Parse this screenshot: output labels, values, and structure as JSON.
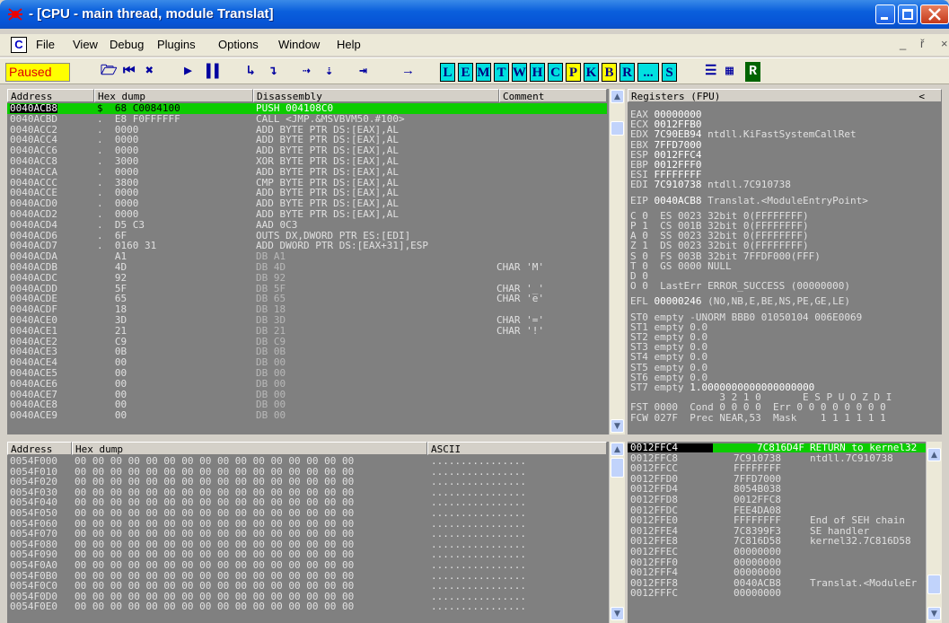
{
  "window": {
    "title": "- [CPU - main thread, module Translat]"
  },
  "menu": {
    "items": [
      "File",
      "View",
      "Debug",
      "Plugins",
      "Options",
      "Window",
      "Help"
    ],
    "mdi": [
      "_",
      "ř",
      "×"
    ]
  },
  "toolbar": {
    "status": "Paused",
    "letters": [
      "L",
      "E",
      "M",
      "T",
      "W",
      "H",
      "C",
      "P",
      "K",
      "B",
      "R",
      "...",
      "S"
    ],
    "highlight": [
      "P",
      "B"
    ]
  },
  "disasm": {
    "headers": {
      "address": "Address",
      "hex": "Hex dump",
      "disasm": "Disassembly",
      "comment": "Comment"
    },
    "rows": [
      [
        "0040ACB8",
        "$  68 C0084100",
        "PUSH 004108C0",
        ""
      ],
      [
        "0040ACBD",
        ".  E8 F0FFFFFF",
        "CALL <JMP.&MSVBVM50.#100>",
        ""
      ],
      [
        "0040ACC2",
        ".  0000",
        "ADD BYTE PTR DS:[EAX],AL",
        ""
      ],
      [
        "0040ACC4",
        ".  0000",
        "ADD BYTE PTR DS:[EAX],AL",
        ""
      ],
      [
        "0040ACC6",
        ".  0000",
        "ADD BYTE PTR DS:[EAX],AL",
        ""
      ],
      [
        "0040ACC8",
        ".  3000",
        "XOR BYTE PTR DS:[EAX],AL",
        ""
      ],
      [
        "0040ACCA",
        ".  0000",
        "ADD BYTE PTR DS:[EAX],AL",
        ""
      ],
      [
        "0040ACCC",
        ".  3800",
        "CMP BYTE PTR DS:[EAX],AL",
        ""
      ],
      [
        "0040ACCE",
        ".  0000",
        "ADD BYTE PTR DS:[EAX],AL",
        ""
      ],
      [
        "0040ACD0",
        ".  0000",
        "ADD BYTE PTR DS:[EAX],AL",
        ""
      ],
      [
        "0040ACD2",
        ".  0000",
        "ADD BYTE PTR DS:[EAX],AL",
        ""
      ],
      [
        "0040ACD4",
        ".  D5 C3",
        "AAD 0C3",
        ""
      ],
      [
        "0040ACD6",
        ".  6F",
        "OUTS DX,DWORD PTR ES:[EDI]",
        ""
      ],
      [
        "0040ACD7",
        ".  0160 31",
        "ADD DWORD PTR DS:[EAX+31],ESP",
        ""
      ],
      [
        "0040ACDA",
        "   A1",
        "DB A1",
        ""
      ],
      [
        "0040ACDB",
        "   4D",
        "DB 4D",
        "CHAR 'M'"
      ],
      [
        "0040ACDC",
        "   92",
        "DB 92",
        ""
      ],
      [
        "0040ACDD",
        "   5F",
        "DB 5F",
        "CHAR '_'"
      ],
      [
        "0040ACDE",
        "   65",
        "DB 65",
        "CHAR 'e'"
      ],
      [
        "0040ACDF",
        "   18",
        "DB 18",
        ""
      ],
      [
        "0040ACE0",
        "   3D",
        "DB 3D",
        "CHAR '='"
      ],
      [
        "0040ACE1",
        "   21",
        "DB 21",
        "CHAR '!'"
      ],
      [
        "0040ACE2",
        "   C9",
        "DB C9",
        ""
      ],
      [
        "0040ACE3",
        "   0B",
        "DB 0B",
        ""
      ],
      [
        "0040ACE4",
        "   00",
        "DB 00",
        ""
      ],
      [
        "0040ACE5",
        "   00",
        "DB 00",
        ""
      ],
      [
        "0040ACE6",
        "   00",
        "DB 00",
        ""
      ],
      [
        "0040ACE7",
        "   00",
        "DB 00",
        ""
      ],
      [
        "0040ACE8",
        "   00",
        "DB 00",
        ""
      ],
      [
        "0040ACE9",
        "   00",
        "DB 00",
        ""
      ]
    ]
  },
  "registers": {
    "header": "Registers (FPU)",
    "header_arrow": "<",
    "lines": [
      [
        "EAX ",
        "00000000",
        ""
      ],
      [
        "ECX ",
        "0012FFB0",
        ""
      ],
      [
        "EDX ",
        "7C90EB94",
        " ntdll.KiFastSystemCallRet"
      ],
      [
        "EBX ",
        "7FFD7000",
        ""
      ],
      [
        "ESP ",
        "0012FFC4",
        ""
      ],
      [
        "EBP ",
        "0012FFF0",
        ""
      ],
      [
        "ESI ",
        "FFFFFFFF",
        ""
      ],
      [
        "EDI ",
        "7C910738",
        " ntdll.7C910738"
      ],
      [
        "",
        "",
        ""
      ],
      [
        "EIP ",
        "0040ACB8",
        " Translat.<ModuleEntryPoint>"
      ],
      [
        "",
        "",
        ""
      ],
      [
        "C 0  ES 0023 32bit 0(FFFFFFFF)",
        "",
        ""
      ],
      [
        "P 1  CS 001B 32bit 0(FFFFFFFF)",
        "",
        ""
      ],
      [
        "A 0  SS 0023 32bit 0(FFFFFFFF)",
        "",
        ""
      ],
      [
        "Z 1  DS 0023 32bit 0(FFFFFFFF)",
        "",
        ""
      ],
      [
        "S 0  FS 003B 32bit 7FFDF000(FFF)",
        "",
        ""
      ],
      [
        "T 0  GS 0000 NULL",
        "",
        ""
      ],
      [
        "D 0",
        "",
        ""
      ],
      [
        "O 0  LastErr ERROR_SUCCESS (00000000)",
        "",
        ""
      ],
      [
        "",
        "",
        ""
      ],
      [
        "EFL ",
        "00000246",
        " (NO,NB,E,BE,NS,PE,GE,LE)"
      ],
      [
        "",
        "",
        ""
      ],
      [
        "ST0 empty -UNORM BBB0 01050104 006E0069",
        "",
        ""
      ],
      [
        "ST1 empty 0.0",
        "",
        ""
      ],
      [
        "ST2 empty 0.0",
        "",
        ""
      ],
      [
        "ST3 empty 0.0",
        "",
        ""
      ],
      [
        "ST4 empty 0.0",
        "",
        ""
      ],
      [
        "ST5 empty 0.0",
        "",
        ""
      ],
      [
        "ST6 empty 0.0",
        "",
        ""
      ],
      [
        "ST7 empty ",
        "1.0000000000000000000",
        ""
      ],
      [
        "               3 2 1 0       E S P U O Z D I",
        "",
        ""
      ],
      [
        "FST 0000  Cond 0 0 0 0  Err 0 0 0 0 0 0 0 0",
        "",
        ""
      ],
      [
        "FCW 027F  Prec NEAR,53  Mask    1 1 1 1 1 1",
        "",
        ""
      ]
    ]
  },
  "dump": {
    "headers": {
      "address": "Address",
      "hex": "Hex dump",
      "ascii": "ASCII"
    },
    "rows": [
      [
        "0054F000",
        "00 00 00 00 00 00 00 00 00 00 00 00 00 00 00 00",
        "................"
      ],
      [
        "0054F010",
        "00 00 00 00 00 00 00 00 00 00 00 00 00 00 00 00",
        "................"
      ],
      [
        "0054F020",
        "00 00 00 00 00 00 00 00 00 00 00 00 00 00 00 00",
        "................"
      ],
      [
        "0054F030",
        "00 00 00 00 00 00 00 00 00 00 00 00 00 00 00 00",
        "................"
      ],
      [
        "0054F040",
        "00 00 00 00 00 00 00 00 00 00 00 00 00 00 00 00",
        "................"
      ],
      [
        "0054F050",
        "00 00 00 00 00 00 00 00 00 00 00 00 00 00 00 00",
        "................"
      ],
      [
        "0054F060",
        "00 00 00 00 00 00 00 00 00 00 00 00 00 00 00 00",
        "................"
      ],
      [
        "0054F070",
        "00 00 00 00 00 00 00 00 00 00 00 00 00 00 00 00",
        "................"
      ],
      [
        "0054F080",
        "00 00 00 00 00 00 00 00 00 00 00 00 00 00 00 00",
        "................"
      ],
      [
        "0054F090",
        "00 00 00 00 00 00 00 00 00 00 00 00 00 00 00 00",
        "................"
      ],
      [
        "0054F0A0",
        "00 00 00 00 00 00 00 00 00 00 00 00 00 00 00 00",
        "................"
      ],
      [
        "0054F0B0",
        "00 00 00 00 00 00 00 00 00 00 00 00 00 00 00 00",
        "................"
      ],
      [
        "0054F0C0",
        "00 00 00 00 00 00 00 00 00 00 00 00 00 00 00 00",
        "................"
      ],
      [
        "0054F0D0",
        "00 00 00 00 00 00 00 00 00 00 00 00 00 00 00 00",
        "................"
      ],
      [
        "0054F0E0",
        "00 00 00 00 00 00 00 00 00 00 00 00 00 00 00 00",
        "................"
      ]
    ]
  },
  "stack": {
    "rows": [
      [
        "0012FFC4",
        "7C816D4F",
        "RETURN to kernel32"
      ],
      [
        "0012FFC8",
        "7C910738",
        "ntdll.7C910738"
      ],
      [
        "0012FFCC",
        "FFFFFFFF",
        ""
      ],
      [
        "0012FFD0",
        "7FFD7000",
        ""
      ],
      [
        "0012FFD4",
        "8054B038",
        ""
      ],
      [
        "0012FFD8",
        "0012FFC8",
        ""
      ],
      [
        "0012FFDC",
        "FEE4DA08",
        ""
      ],
      [
        "0012FFE0",
        "FFFFFFFF",
        "End of SEH chain"
      ],
      [
        "0012FFE4",
        "7C8399F3",
        "SE handler"
      ],
      [
        "0012FFE8",
        "7C816D58",
        "kernel32.7C816D58"
      ],
      [
        "0012FFEC",
        "00000000",
        ""
      ],
      [
        "0012FFF0",
        "00000000",
        ""
      ],
      [
        "0012FFF4",
        "00000000",
        ""
      ],
      [
        "0012FFF8",
        "0040ACB8",
        "Translat.<ModuleEr"
      ],
      [
        "0012FFFC",
        "00000000",
        ""
      ]
    ]
  },
  "colors": {
    "bg": "#808080",
    "text": "#e0e0e0",
    "highlight": "#0ccc00",
    "reg_changed": "#ffffff",
    "selected": "#000000"
  }
}
